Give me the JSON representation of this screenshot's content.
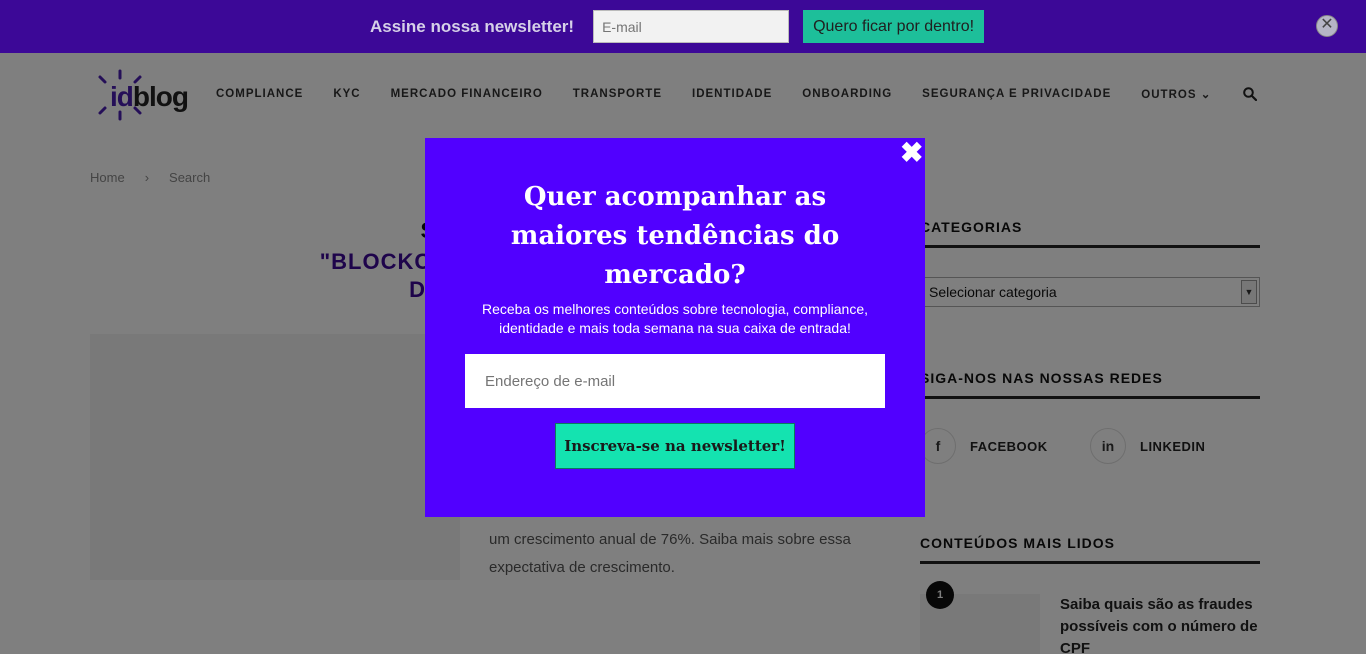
{
  "topbar": {
    "label": "Assine nossa newsletter!",
    "email_placeholder": "E-mail",
    "button": "Quero ficar por dentro!",
    "close": "✕"
  },
  "header": {
    "logo_id": "id",
    "logo_blog": "blog",
    "nav": [
      "COMPLIANCE",
      "KYC",
      "MERCADO FINANCEIRO",
      "TRANSPORTE",
      "IDENTIDADE",
      "ONBOARDING",
      "SEGURANÇA E PRIVACIDADE",
      "OUTROS"
    ]
  },
  "breadcrumb": {
    "home": "Home",
    "separator": "›",
    "current": "Search"
  },
  "search": {
    "heading": "SEARCH",
    "query_line1": "\"BLOCKCHAIN CONTINUA",
    "query_line2": "DEVEM TR"
  },
  "article": {
    "excerpt": "um crescimento anual de 76%. Saiba mais sobre essa expectativa de crescimento."
  },
  "sidebar": {
    "categories_title": "CATEGORIAS",
    "categories_select": "Selecionar categoria",
    "social_title": "SIGA-NOS NAS NOSSAS REDES",
    "facebook": "FACEBOOK",
    "linkedin": "LINKEDIN",
    "popular_title": "CONTEÚDOS MAIS LIDOS",
    "popular_rank": "1",
    "popular_item": "Saiba quais são as fraudes possíveis com o número de CPF"
  },
  "modal": {
    "title": "Quer acompanhar as maiores tendências do mercado?",
    "subtitle": "Receba os melhores conteúdos sobre tecnologia, compliance, identidade e mais toda semana na sua caixa de entrada!",
    "email_placeholder": "Endereço de e-mail",
    "button": "Inscreva-se na newsletter!",
    "close": "✖"
  },
  "colors": {
    "topbar_bg": "#3c0897",
    "modal_bg": "#5100ff",
    "accent_green": "#14e3b0"
  }
}
